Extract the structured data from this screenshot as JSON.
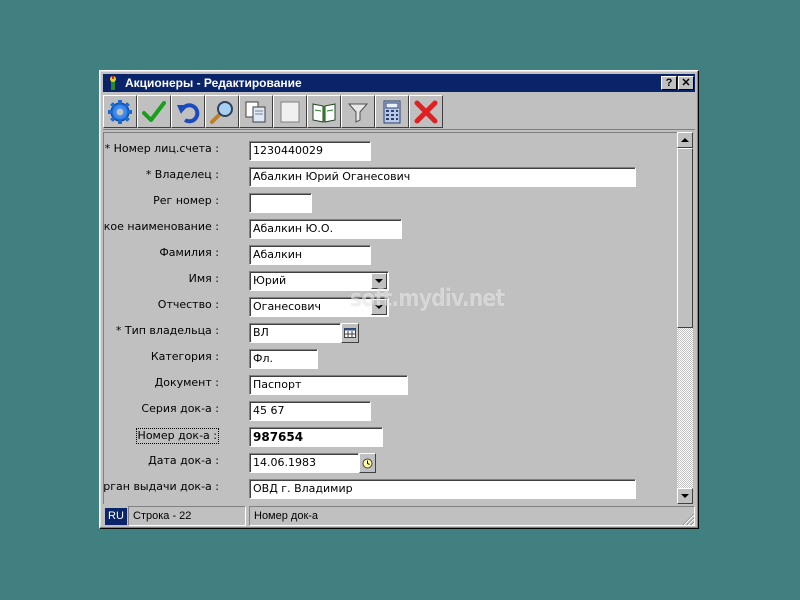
{
  "window": {
    "title": "Акционеры - Редактирование",
    "help_btn": "?",
    "close_btn": "✕"
  },
  "toolbar": {
    "buttons": [
      {
        "name": "settings",
        "icon": "gear-icon"
      },
      {
        "name": "save",
        "icon": "checkmark-icon"
      },
      {
        "name": "undo",
        "icon": "undo-arrow-icon"
      },
      {
        "name": "search",
        "icon": "magnifier-icon"
      },
      {
        "name": "copy",
        "icon": "copy-icon"
      },
      {
        "name": "blank",
        "icon": "blank-icon"
      },
      {
        "name": "book",
        "icon": "book-icon"
      },
      {
        "name": "filter",
        "icon": "funnel-icon"
      },
      {
        "name": "calculator",
        "icon": "calculator-icon"
      },
      {
        "name": "close",
        "icon": "red-x-icon"
      }
    ]
  },
  "form": {
    "account": {
      "label": "* Номер лиц.счета :",
      "value": "1230440029"
    },
    "owner": {
      "label": "* Владелец :",
      "value": "Абалкин Юрий Оганесович"
    },
    "reg_no": {
      "label": "Рег номер :",
      "value": ""
    },
    "short_name": {
      "label": "Краткое наименование :",
      "value": "Абалкин Ю.О."
    },
    "surname": {
      "label": "Фамилия :",
      "value": "Абалкин"
    },
    "first_name": {
      "label": "Имя :",
      "value": "Юрий"
    },
    "patronymic": {
      "label": "Отчество :",
      "value": "Оганесович"
    },
    "owner_type": {
      "label": "* Тип владельца :",
      "value": "ВЛ"
    },
    "category": {
      "label": "Категория :",
      "value": "Фл."
    },
    "document": {
      "label": "Документ :",
      "value": "Паспорт"
    },
    "doc_series": {
      "label": "Серия док-а :",
      "value": "45 67"
    },
    "doc_number": {
      "label": "Номер док-а :",
      "value": "987654"
    },
    "doc_date": {
      "label": "Дата док-а :",
      "value": "14.06.1983"
    },
    "issuer": {
      "label": "Орган выдачи док-а :",
      "value": "ОВД г. Владимир"
    }
  },
  "status": {
    "lang": "RU",
    "row": "Строка - 22",
    "field": "Номер док-а"
  },
  "watermark": "soft.mydiv.net",
  "colors": {
    "desktop": "#408080",
    "titlebar": "#0a246a",
    "window": "#c0c0c0"
  }
}
